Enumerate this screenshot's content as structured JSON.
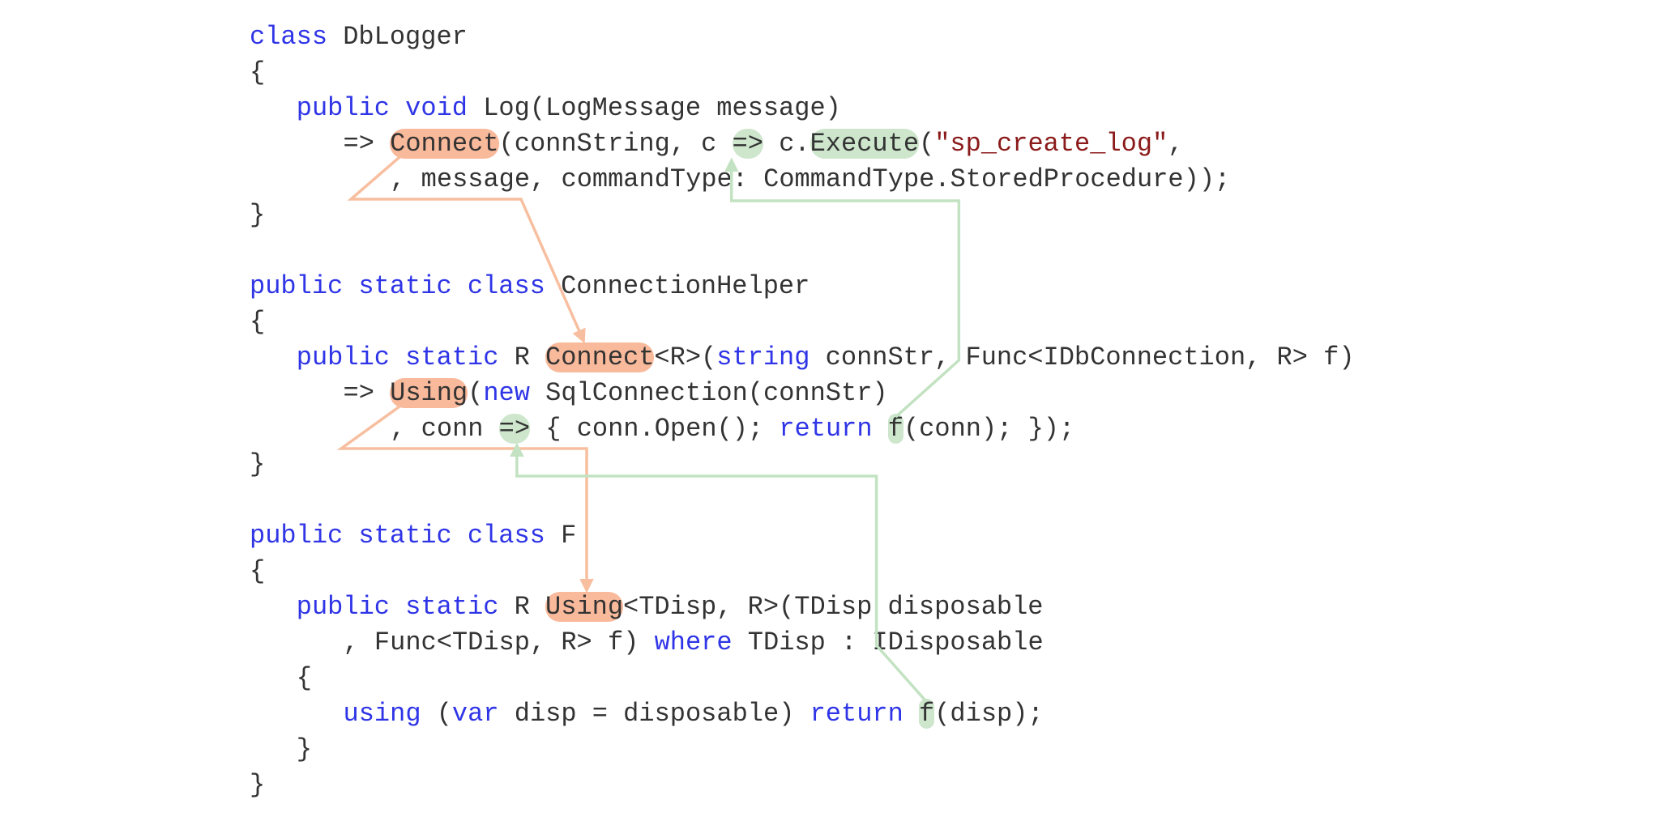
{
  "colors": {
    "keyword": "#2f35e6",
    "string": "#8b1a1a",
    "text": "#333333",
    "orange_highlight": "#f9b99b",
    "orange_arrow": "#f7bfa0",
    "green_highlight": "#cde6cc",
    "green_arrow": "#c3e2c2"
  },
  "lines": [
    {
      "indent": 0,
      "segs": [
        {
          "t": "class",
          "c": "kw"
        },
        {
          "t": " DbLogger"
        }
      ]
    },
    {
      "indent": 0,
      "segs": [
        {
          "t": "{"
        }
      ]
    },
    {
      "indent": 1,
      "segs": [
        {
          "t": "public",
          "c": "kw"
        },
        {
          "t": " "
        },
        {
          "t": "void",
          "c": "kw"
        },
        {
          "t": " Log(LogMessage message)"
        }
      ]
    },
    {
      "indent": 2,
      "segs": [
        {
          "t": "=> "
        },
        {
          "t": "Connect",
          "h": "o",
          "id": "A1"
        },
        {
          "t": "(connString, c "
        },
        {
          "t": "=>",
          "h": "g",
          "id": "B1"
        },
        {
          "t": " c."
        },
        {
          "t": "Execute",
          "h": "g",
          "id": "B2"
        },
        {
          "t": "("
        },
        {
          "t": "\"sp_create_log\"",
          "c": "str"
        },
        {
          "t": ","
        }
      ]
    },
    {
      "indent": 3,
      "segs": [
        {
          "t": ", message, commandType: CommandType.StoredProcedure));"
        }
      ]
    },
    {
      "indent": 0,
      "segs": [
        {
          "t": "}"
        }
      ]
    },
    {
      "indent": 0,
      "segs": []
    },
    {
      "indent": 0,
      "segs": [
        {
          "t": "public",
          "c": "kw"
        },
        {
          "t": " "
        },
        {
          "t": "static",
          "c": "kw"
        },
        {
          "t": " "
        },
        {
          "t": "class",
          "c": "kw"
        },
        {
          "t": " ConnectionHelper"
        }
      ]
    },
    {
      "indent": 0,
      "segs": [
        {
          "t": "{"
        }
      ]
    },
    {
      "indent": 1,
      "segs": [
        {
          "t": "public",
          "c": "kw"
        },
        {
          "t": " "
        },
        {
          "t": "static",
          "c": "kw"
        },
        {
          "t": " R "
        },
        {
          "t": "Connect",
          "h": "o",
          "id": "A2"
        },
        {
          "t": "<R>("
        },
        {
          "t": "string",
          "c": "kw"
        },
        {
          "t": " connStr, Func<IDbConnection, R> f)"
        }
      ]
    },
    {
      "indent": 2,
      "segs": [
        {
          "t": "=> "
        },
        {
          "t": "Using",
          "h": "o",
          "id": "C1"
        },
        {
          "t": "("
        },
        {
          "t": "new",
          "c": "kw"
        },
        {
          "t": " SqlConnection(connStr)"
        }
      ]
    },
    {
      "indent": 3,
      "segs": [
        {
          "t": ", conn "
        },
        {
          "t": "=>",
          "h": "g",
          "id": "D1"
        },
        {
          "t": " { conn.Open(); "
        },
        {
          "t": "return",
          "c": "kw"
        },
        {
          "t": " "
        },
        {
          "t": "f",
          "h": "g",
          "id": "D2"
        },
        {
          "t": "(conn); });"
        }
      ]
    },
    {
      "indent": 0,
      "segs": [
        {
          "t": "}"
        }
      ]
    },
    {
      "indent": 0,
      "segs": []
    },
    {
      "indent": 0,
      "segs": [
        {
          "t": "public",
          "c": "kw"
        },
        {
          "t": " "
        },
        {
          "t": "static",
          "c": "kw"
        },
        {
          "t": " "
        },
        {
          "t": "class",
          "c": "kw"
        },
        {
          "t": " F"
        }
      ]
    },
    {
      "indent": 0,
      "segs": [
        {
          "t": "{"
        }
      ]
    },
    {
      "indent": 1,
      "segs": [
        {
          "t": "public",
          "c": "kw"
        },
        {
          "t": " "
        },
        {
          "t": "static",
          "c": "kw"
        },
        {
          "t": " R "
        },
        {
          "t": "Using",
          "h": "o",
          "id": "C2"
        },
        {
          "t": "<TDisp, R>(TDisp disposable"
        }
      ]
    },
    {
      "indent": 2,
      "segs": [
        {
          "t": ", Func<TDisp, R> f) "
        },
        {
          "t": "where",
          "c": "kw"
        },
        {
          "t": " TDisp : IDisposable"
        }
      ]
    },
    {
      "indent": 1,
      "segs": [
        {
          "t": "{"
        }
      ]
    },
    {
      "indent": 2,
      "segs": [
        {
          "t": "using",
          "c": "kw"
        },
        {
          "t": " ("
        },
        {
          "t": "var",
          "c": "kw"
        },
        {
          "t": " disp = disposable) "
        },
        {
          "t": "return",
          "c": "kw"
        },
        {
          "t": " "
        },
        {
          "t": "f",
          "h": "g",
          "id": "E1"
        },
        {
          "t": "(disp);"
        }
      ]
    },
    {
      "indent": 1,
      "segs": [
        {
          "t": "}"
        }
      ]
    },
    {
      "indent": 0,
      "segs": [
        {
          "t": "}"
        }
      ]
    }
  ],
  "arrows": [
    {
      "from": "A1",
      "to": "A2",
      "color": "orange"
    },
    {
      "from": "C1",
      "to": "C2",
      "color": "orange"
    },
    {
      "from": "D2",
      "to": "B1",
      "color": "green"
    },
    {
      "from": "E1",
      "to": "D1",
      "color": "green"
    }
  ]
}
